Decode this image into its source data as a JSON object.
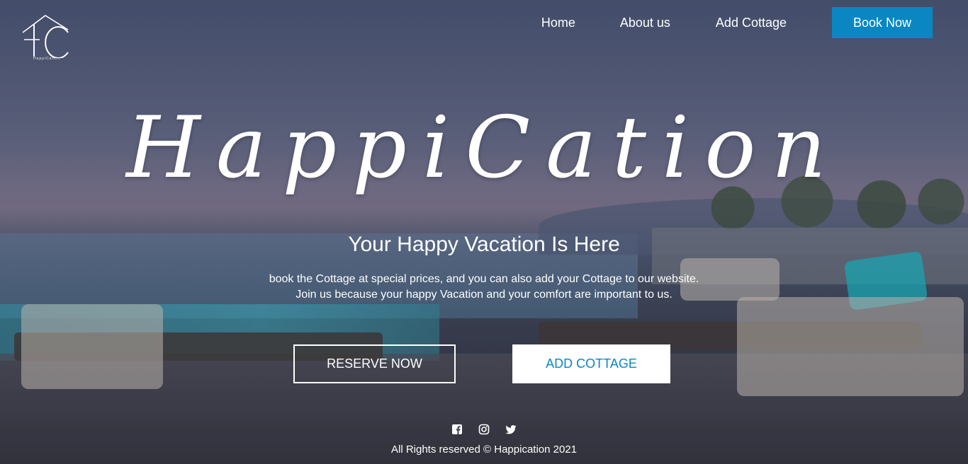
{
  "logo": {
    "initials": "HC",
    "subtext": "HappiCation"
  },
  "nav": {
    "items": [
      "Home",
      "About us",
      "Add Cottage"
    ],
    "cta": "Book Now"
  },
  "hero": {
    "brand": "HappiCation",
    "tagline": "Your Happy Vacation Is Here",
    "desc_line1": "book the Cottage at special prices, and you can also add your Cottage to our website.",
    "desc_line2": "Join us because your happy Vacation and your comfort are important to us.",
    "primary_button": "RESERVE NOW",
    "secondary_button": "ADD COTTAGE"
  },
  "socials": [
    "facebook-icon",
    "instagram-icon",
    "twitter-icon"
  ],
  "footer": {
    "text": "All Rights reserved © Happication 2021"
  },
  "colors": {
    "accent": "#0a87c2",
    "text": "#ffffff"
  }
}
